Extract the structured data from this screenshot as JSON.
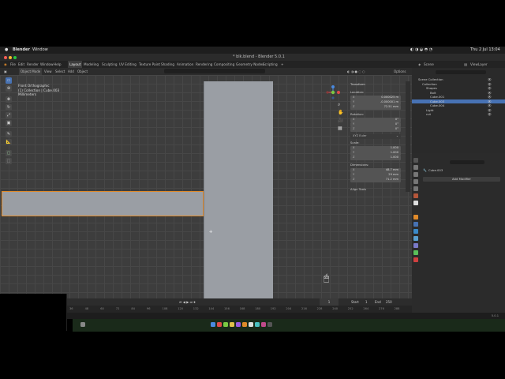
{
  "macos_menubar": {
    "app_name": "Blender",
    "menu_window": "Window",
    "clock": "Thu 2 Jul 13:04"
  },
  "window": {
    "title": "* blk.blend - Blender 5.0.1"
  },
  "topbar": {
    "menus": [
      "File",
      "Edit",
      "Render",
      "Window",
      "Help"
    ],
    "workspaces": [
      "Layout",
      "Modeling",
      "Sculpting",
      "UV Editing",
      "Texture Paint",
      "Shading",
      "Animation",
      "Rendering",
      "Compositing",
      "Geometry Nodes",
      "Scripting"
    ],
    "active_workspace": "Layout",
    "add_tab": "+",
    "scene_label": "Scene",
    "view_layer_label": "ViewLayer"
  },
  "viewport_header": {
    "mode": "Object Mode",
    "menus": [
      "View",
      "Select",
      "Add",
      "Object"
    ],
    "transform_orientation": "Global",
    "options_label": "Options"
  },
  "viewport_overlay": {
    "line1": "Front Orthographic",
    "line2": "(1) Collection | Cube.003",
    "line3": "Millimeters"
  },
  "npanel": {
    "transform_header": "Transform",
    "location_label": "Location:",
    "location": [
      {
        "axis": "X",
        "value": "0.000025 m"
      },
      {
        "axis": "Y",
        "value": "-0.000001 m"
      },
      {
        "axis": "Z",
        "value": "72.51 mm"
      }
    ],
    "rotation_label": "Rotation:",
    "rotation": [
      {
        "axis": "X",
        "value": "0°"
      },
      {
        "axis": "Y",
        "value": "0°"
      },
      {
        "axis": "Z",
        "value": "0°"
      }
    ],
    "rotation_mode": "XYZ Euler",
    "scale_label": "Scale:",
    "scale": [
      {
        "axis": "X",
        "value": "1.000"
      },
      {
        "axis": "Y",
        "value": "1.000"
      },
      {
        "axis": "Z",
        "value": "1.000"
      }
    ],
    "dimensions_label": "Dimensions:",
    "dimensions": [
      {
        "axis": "X",
        "value": "48.7 mm"
      },
      {
        "axis": "Y",
        "value": "29 mm"
      },
      {
        "axis": "Z",
        "value": "71.2 mm"
      }
    ],
    "align_tools": "Align Tools"
  },
  "timeline": {
    "frame_current": "1",
    "start_label": "Start",
    "start": "1",
    "end_label": "End",
    "end": "250",
    "ticks": [
      "36",
      "48",
      "60",
      "72",
      "84",
      "96",
      "108",
      "120",
      "132",
      "144",
      "156",
      "168",
      "180",
      "192",
      "204",
      "216",
      "228",
      "240",
      "252",
      "264",
      "276",
      "288"
    ]
  },
  "statusbar": {
    "version": "5.0.1"
  },
  "outliner": {
    "search_placeholder": "",
    "rows": [
      {
        "label": "Scene Collection",
        "indent": 0
      },
      {
        "label": "Collection",
        "indent": 1
      },
      {
        "label": "Shapes",
        "indent": 2
      },
      {
        "label": "Bolt",
        "indent": 3
      },
      {
        "label": "Cube.001",
        "indent": 3
      },
      {
        "label": "Cube.003",
        "indent": 3,
        "selected": true
      },
      {
        "label": "Cube.004",
        "indent": 3
      },
      {
        "label": "Light",
        "indent": 2
      },
      {
        "label": "cut",
        "indent": 2
      }
    ]
  },
  "properties": {
    "object_name": "Cube.003",
    "add_modifier": "Add Modifier"
  },
  "colors": {
    "accent_orange": "#e08a2a",
    "selection_blue": "#4772b3",
    "axis_x": "#e04a4a",
    "axis_y": "#7ac943",
    "axis_z": "#4a8ae0"
  }
}
